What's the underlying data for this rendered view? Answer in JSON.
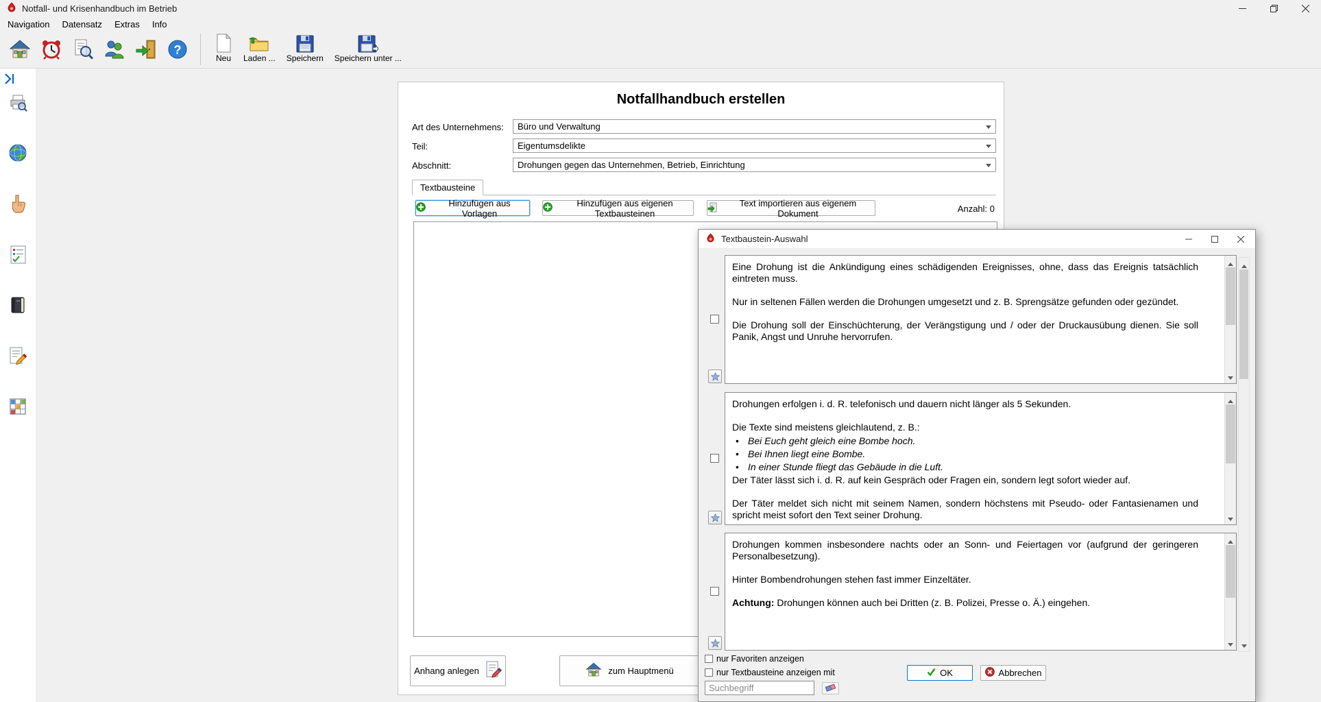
{
  "colors": {
    "accent_blue": "#0078d7",
    "green": "#2da42d",
    "red": "#c23030",
    "window_bg": "#f0f0f0"
  },
  "window": {
    "title": "Notfall- und Krisenhandbuch im Betrieb"
  },
  "menubar": {
    "items": [
      "Navigation",
      "Datensatz",
      "Extras",
      "Info"
    ]
  },
  "toolbar": {
    "nav_icons": [
      "home-icon",
      "alarm-clock-icon",
      "search-preview-icon",
      "users-icon",
      "exit-icon",
      "help-icon"
    ],
    "file_buttons": [
      {
        "label": "Neu",
        "icon": "new-document-icon"
      },
      {
        "label": "Laden ...",
        "icon": "open-folder-icon"
      },
      {
        "label": "Speichern",
        "icon": "save-icon"
      },
      {
        "label": "Speichern unter ...",
        "icon": "save-as-icon"
      }
    ]
  },
  "sidebar": {
    "icons": [
      "collapse-sidebar-icon",
      "print-preview-icon",
      "globe-icon",
      "hand-pointer-icon",
      "checklist-document-icon",
      "book-icon",
      "edit-document-icon",
      "table-grid-icon"
    ]
  },
  "main": {
    "title": "Notfallhandbuch erstellen",
    "fields": [
      {
        "label": "Art des Unternehmens:",
        "value": "Büro und Verwaltung"
      },
      {
        "label": "Teil:",
        "value": "Eigentumsdelikte"
      },
      {
        "label": "Abschnitt:",
        "value": "Drohungen gegen das Unternehmen, Betrieb, Einrichtung"
      }
    ],
    "tab_label": "Textbausteine",
    "action_buttons": [
      {
        "label": "Hinzufügen aus Vorlagen"
      },
      {
        "label": "Hinzufügen aus eigenen Textbausteinen"
      },
      {
        "label": "Text importieren aus eigenem Dokument"
      }
    ],
    "count_label": "Anzahl: 0",
    "footer_buttons": [
      {
        "label": "Anhang anlegen"
      },
      {
        "label": "zum Hauptmenü"
      }
    ]
  },
  "dialog": {
    "title": "Textbaustein-Auswahl",
    "items": [
      {
        "checked": false,
        "paragraphs": [
          {
            "type": "text",
            "text": "Eine Drohung ist die Ankündigung eines schädigenden Ereignisses, ohne, dass das Ereignis tatsächlich eintreten muss."
          },
          {
            "type": "text",
            "text": "Nur in seltenen Fällen werden die Drohungen umgesetzt und z. B. Sprengsätze gefunden oder gezündet."
          },
          {
            "type": "text",
            "text": "Die Drohung soll der Einschüchterung, der Verängstigung und / oder der Druckausübung dienen. Sie soll Panik, Angst und Unruhe hervorrufen."
          }
        ]
      },
      {
        "checked": false,
        "paragraphs": [
          {
            "type": "text",
            "text": "Drohungen erfolgen i. d. R. telefonisch und dauern nicht länger als 5 Sekunden."
          },
          {
            "type": "text",
            "tight": true,
            "text": "Die Texte sind meistens gleichlautend, z. B.:"
          },
          {
            "type": "bullet",
            "text": "Bei Euch geht gleich eine Bombe hoch."
          },
          {
            "type": "bullet",
            "text": "Bei Ihnen liegt eine Bombe."
          },
          {
            "type": "bullet",
            "text": "In einer Stunde fliegt das Gebäude in die Luft."
          },
          {
            "type": "text",
            "text": "Der Täter lässt sich i. d. R. auf kein Gespräch oder Fragen ein, sondern legt sofort wieder auf."
          },
          {
            "type": "text",
            "text": "Der Täter meldet sich nicht mit seinem Namen, sondern höchstens mit Pseudo- oder Fantasienamen und spricht meist sofort den Text seiner Drohung."
          }
        ]
      },
      {
        "checked": false,
        "paragraphs": [
          {
            "type": "text",
            "text": "Drohungen kommen insbesondere nachts oder an Sonn- und Feiertagen vor (aufgrund der geringeren Personalbesetzung)."
          },
          {
            "type": "text",
            "text": "Hinter Bombendrohungen stehen fast immer Einzeltäter."
          },
          {
            "type": "text",
            "bold_prefix": "Achtung:",
            "text": " Drohungen können auch bei Dritten (z. B. Polizei, Presse o. Ä.) eingehen."
          }
        ]
      }
    ],
    "footer": {
      "favorites_checkbox_label": "nur Favoriten anzeigen",
      "filter_checkbox_label": "nur Textbausteine anzeigen mit",
      "search_placeholder": "Suchbegriff",
      "ok_label": "OK",
      "cancel_label": "Abbrechen"
    }
  }
}
